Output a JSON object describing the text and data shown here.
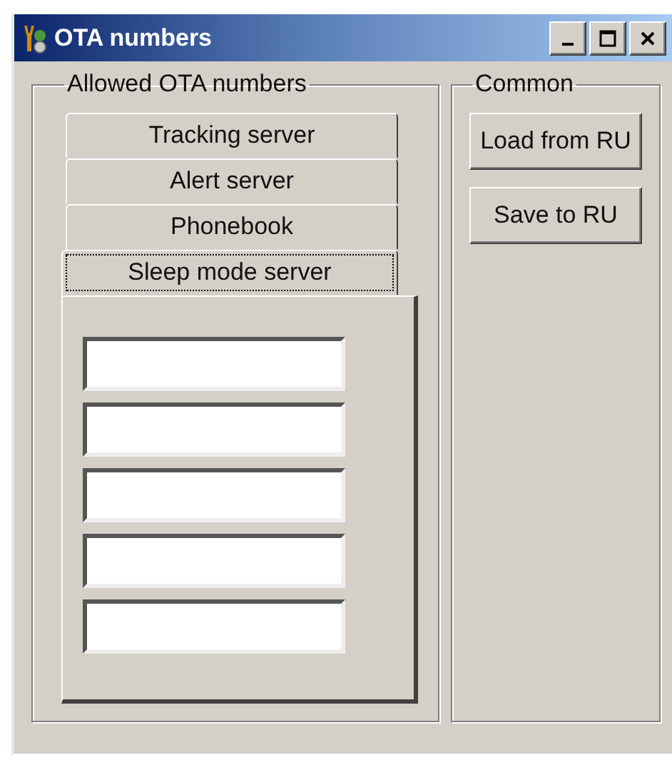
{
  "window": {
    "title": "OTA numbers"
  },
  "allowed_group": {
    "title": "Allowed OTA numbers",
    "tabs": [
      {
        "label": "Tracking server",
        "selected": false
      },
      {
        "label": "Alert server",
        "selected": false
      },
      {
        "label": "Phonebook",
        "selected": false
      },
      {
        "label": "Sleep mode server",
        "selected": true
      }
    ],
    "fields": [
      {
        "kind": "input"
      },
      {
        "kind": "input"
      },
      {
        "kind": "input"
      },
      {
        "kind": "input"
      },
      {
        "kind": "input"
      }
    ]
  },
  "common_group": {
    "title": "Common",
    "buttons": [
      "Load from RU",
      "Save to RU"
    ]
  }
}
